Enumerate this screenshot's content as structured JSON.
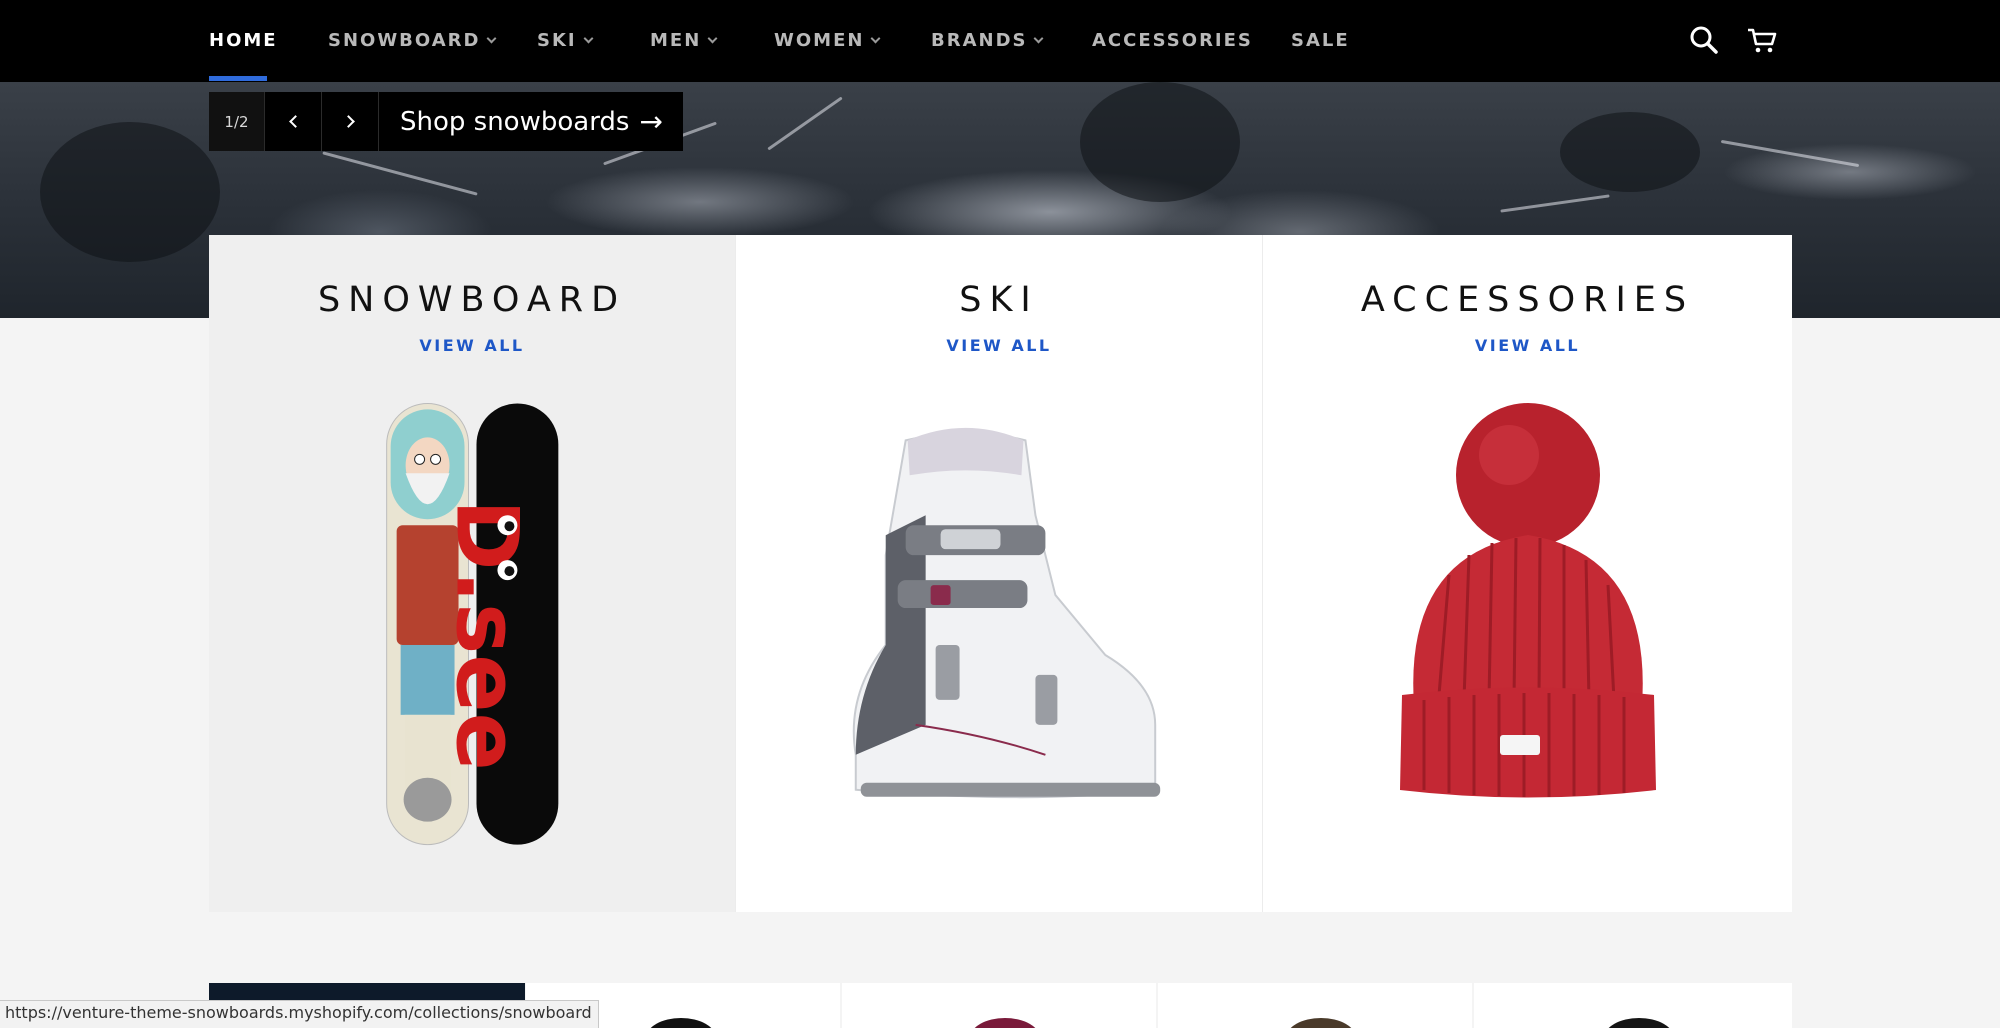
{
  "nav": {
    "items": [
      {
        "label": "HOME",
        "active": true,
        "dropdown": false
      },
      {
        "label": "SNOWBOARD",
        "active": false,
        "dropdown": true
      },
      {
        "label": "SKI",
        "active": false,
        "dropdown": true
      },
      {
        "label": "MEN",
        "active": false,
        "dropdown": true
      },
      {
        "label": "WOMEN",
        "active": false,
        "dropdown": true
      },
      {
        "label": "BRANDS",
        "active": false,
        "dropdown": true
      },
      {
        "label": "ACCESSORIES",
        "active": false,
        "dropdown": false
      },
      {
        "label": "SALE",
        "active": false,
        "dropdown": false
      }
    ],
    "icons": [
      "search-icon",
      "cart-icon"
    ],
    "accent": "#2f6bdc"
  },
  "hero": {
    "slide_counter": "1/2",
    "cta_label": "Shop snowboards",
    "cta_arrow": "→"
  },
  "collections": [
    {
      "title": "SNOWBOARD",
      "link": "VIEW ALL",
      "image": "snowboards-image"
    },
    {
      "title": "SKI",
      "link": "VIEW ALL",
      "image": "ski-boot-image"
    },
    {
      "title": "ACCESSORIES",
      "link": "VIEW ALL",
      "image": "red-beanie-image"
    }
  ],
  "status_bar": {
    "url": "https://venture-theme-snowboards.myshopify.com/collections/snowboard"
  },
  "colors": {
    "link": "#1e57c7",
    "nav_bg": "#000000",
    "page_bg": "#f4f4f4"
  }
}
